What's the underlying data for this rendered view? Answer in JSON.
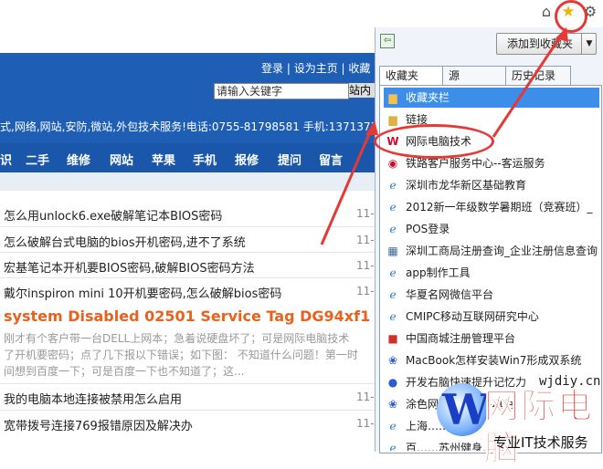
{
  "toolbar": {
    "home_icon": "home-icon",
    "star_icon": "star-icon",
    "gear_icon": "gear-icon"
  },
  "site": {
    "top_links": [
      "登录",
      "设为主页",
      "收藏"
    ],
    "search_placeholder": "请输入关键字",
    "search_button_partial": "站内",
    "contact_text": "式,网络,网站,安防,微站,外包技术服务!电话:0755-81798581 手机:1371373",
    "nav": [
      "识",
      "二手",
      "维修",
      "网站",
      "苹果",
      "手机",
      "报修",
      "提问",
      "留言"
    ],
    "articles": [
      "怎么用unlock6.exe破解笔记本BIOS密码",
      "怎么破解台式电脑的bios开机密码,进不了系统",
      "宏基笔记本开机要BIOS密码,破解BIOS密码方法",
      "戴尔inspiron mini 10开机要密码,怎么破解bios密码"
    ],
    "featured_title": "system Disabled 02501 Service Tag DG94xf1",
    "featured_excerpt": [
      "刚才有个客户带一台DELL上网本；急着说硬盘坏了；可是网际电脑技术",
      "了开机要密码；点了几下报以下错误；如下图： 不知道什么问题！第一时",
      "间想到百度一下；可是百度一下也不知道了；这..."
    ],
    "articles_bottom": [
      "我的电脑本地连接被禁用怎么启用",
      "宽带拨号连接769报错原因及解决办"
    ],
    "date_partial": "11-"
  },
  "favorites": {
    "add_button_label": "添加到收藏夹",
    "tabs": [
      "收藏夹",
      "源",
      "历史记录"
    ],
    "items": [
      {
        "label": "收藏夹栏",
        "icon": "folder-icon"
      },
      {
        "label": "链接",
        "icon": "folder-icon"
      },
      {
        "label": "网际电脑技术",
        "icon": "site-w-icon"
      },
      {
        "label": "铁路客户服务中心--客运服务",
        "icon": "railway-icon"
      },
      {
        "label": "深圳市龙华新区基础教育",
        "icon": "ie-page-icon"
      },
      {
        "label": "2012新一年级数学暑期班（竞赛班）_",
        "icon": "ie-page-icon"
      },
      {
        "label": "POS登录",
        "icon": "ie-page-icon"
      },
      {
        "label": "深圳工商局注册查询_企业注册信息查询",
        "icon": "grid-icon"
      },
      {
        "label": "app制作工具",
        "icon": "ie-page-icon"
      },
      {
        "label": "华夏名网微信平台",
        "icon": "ie-page-icon"
      },
      {
        "label": "CMIPC移动互联网研究中心",
        "icon": "ie-page-icon"
      },
      {
        "label": "中国商城注册管理平台",
        "icon": "red-square-icon"
      },
      {
        "label": "MacBook怎样安装Win7形成双系统",
        "icon": "paw-icon"
      },
      {
        "label": "开发右脑快速提升记忆力",
        "icon": "blue-circle-icon"
      },
      {
        "label": "涂色网_百度知道-填色",
        "icon": "paw-icon"
      },
      {
        "label": "上海……",
        "icon": "ie-page-icon"
      },
      {
        "label": "百……苏州健身……",
        "icon": "ie-page-icon"
      }
    ]
  },
  "watermark": {
    "domain": "wjdiy.cn",
    "brand": "网际电脑",
    "slogan": "专业IT技术服务"
  }
}
